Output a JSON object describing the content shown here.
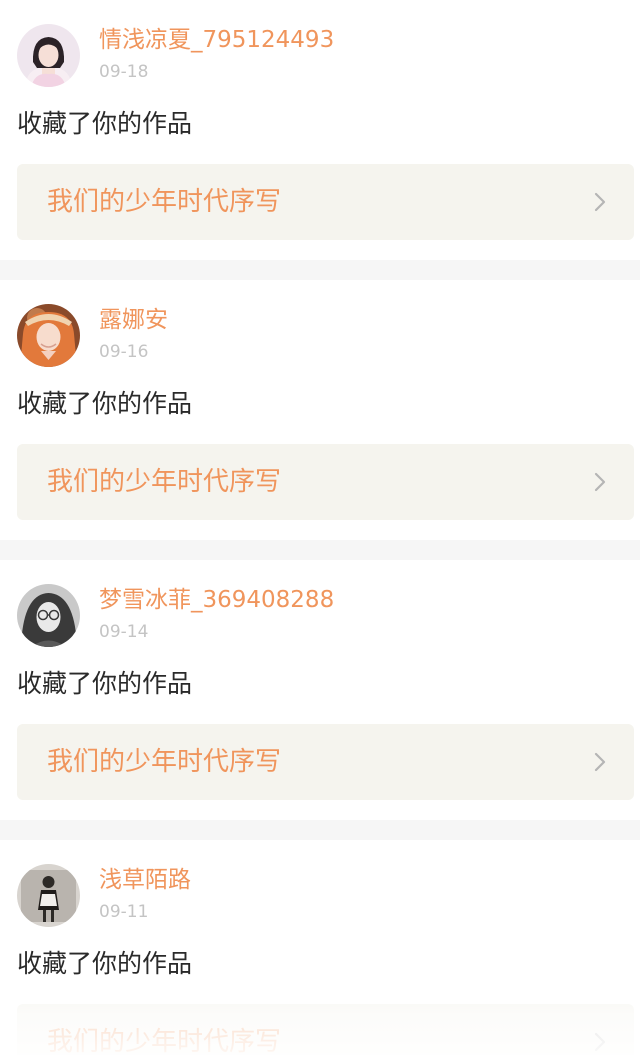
{
  "theme": {
    "accent": "#f0955c",
    "link_bg": "#f5f4ee",
    "chevron": "#b5b5b5"
  },
  "notifications": [
    {
      "username": "情浅凉夏_795124493",
      "date": "09-18",
      "action": "收藏了你的作品",
      "work_title": "我们的少年时代序写",
      "avatar_icon": "avatar-girl-light-icon"
    },
    {
      "username": "露娜安",
      "date": "09-16",
      "action": "收藏了你的作品",
      "work_title": "我们的少年时代序写",
      "avatar_icon": "avatar-orange-hair-icon"
    },
    {
      "username": "梦雪冰菲_369408288",
      "date": "09-14",
      "action": "收藏了你的作品",
      "work_title": "我们的少年时代序写",
      "avatar_icon": "avatar-glasses-icon"
    },
    {
      "username": "浅草陌路",
      "date": "09-11",
      "action": "收藏了你的作品",
      "work_title": "我们的少年时代序写",
      "avatar_icon": "avatar-standing-figure-icon"
    }
  ]
}
